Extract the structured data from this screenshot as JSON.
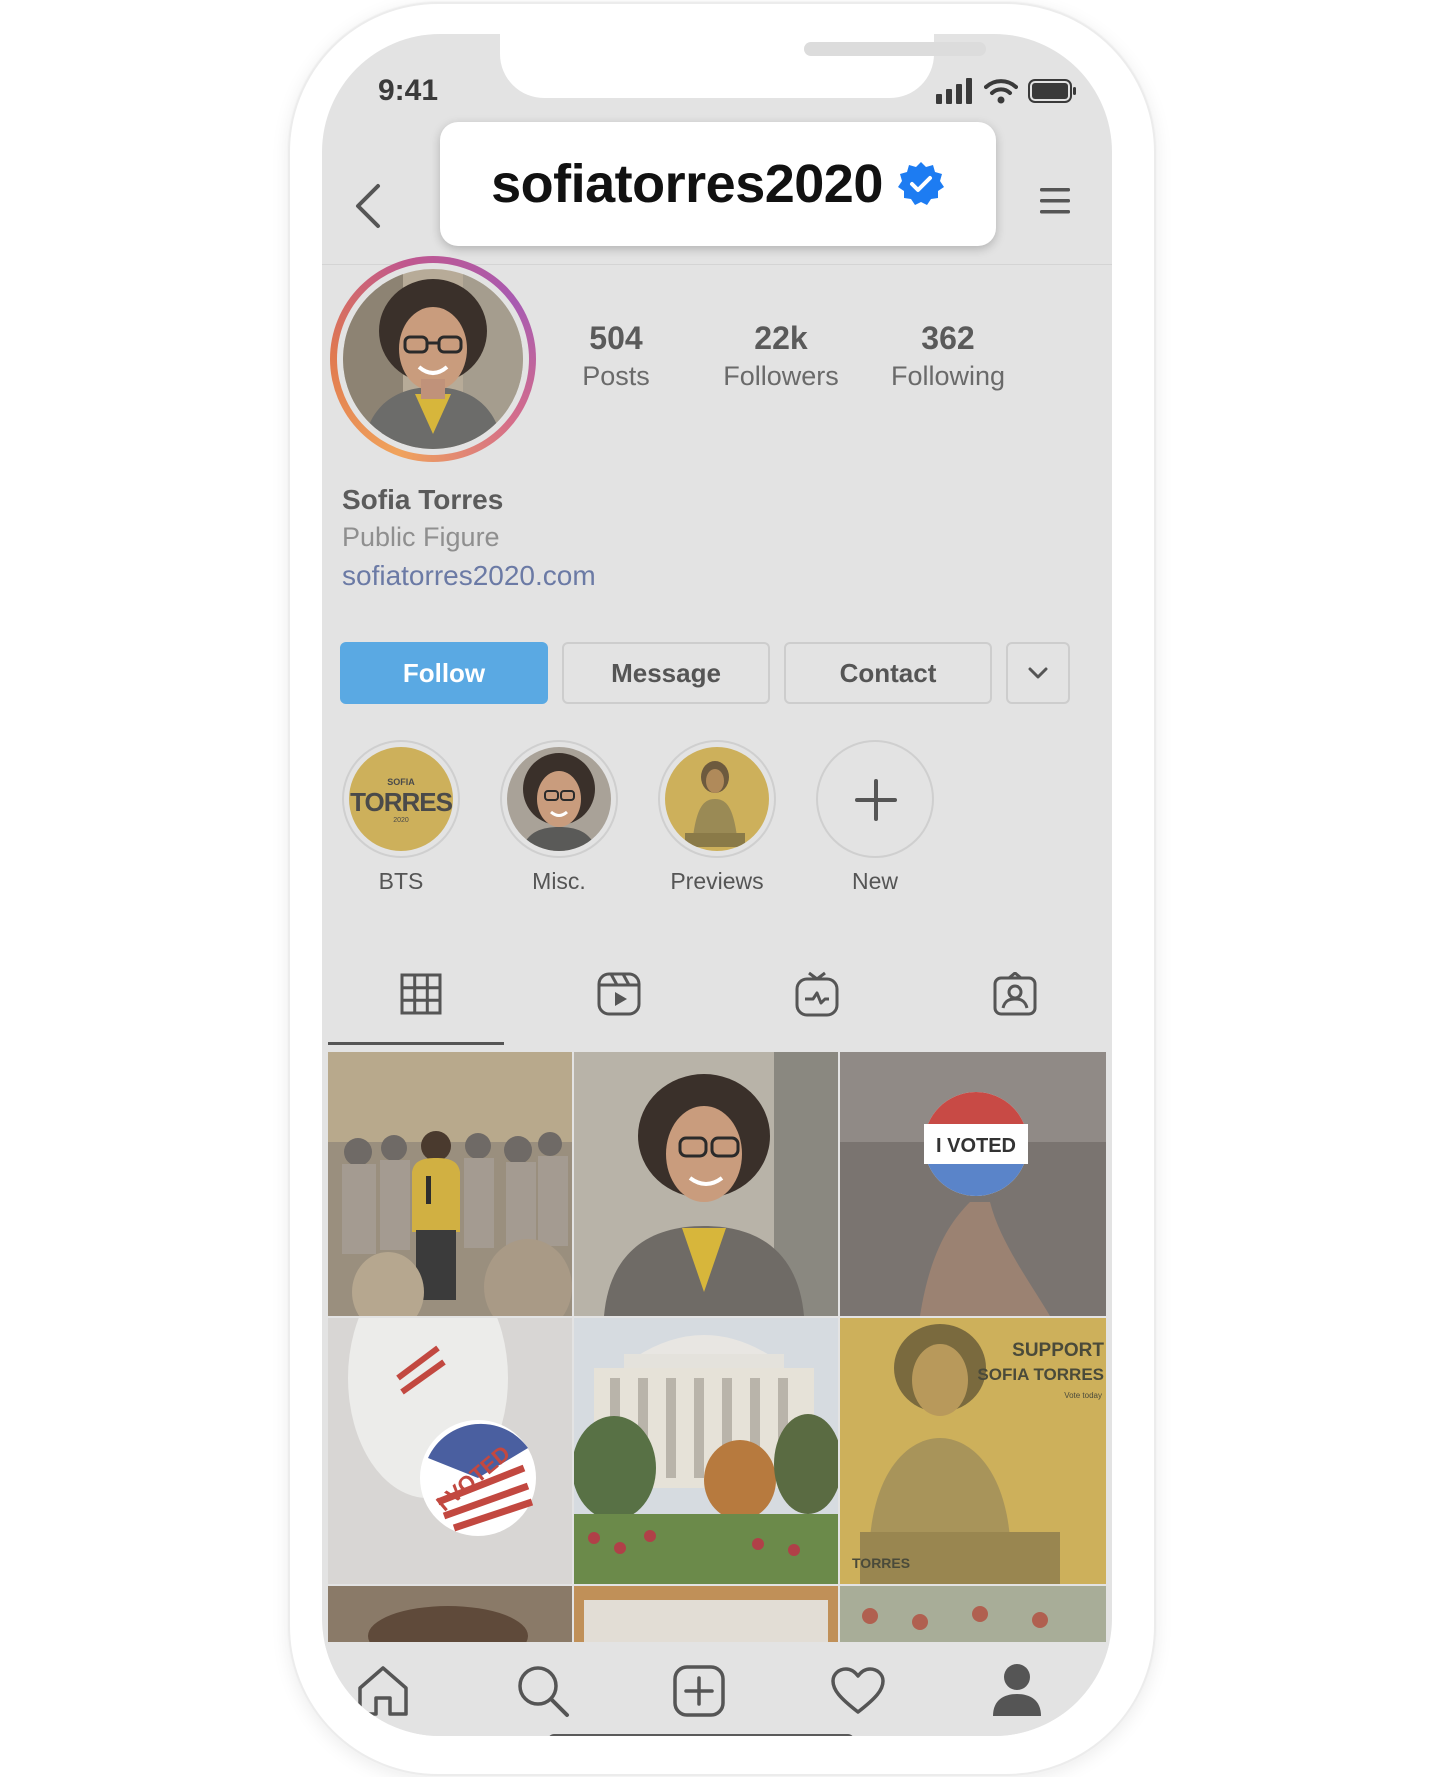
{
  "status_bar": {
    "time": "9:41"
  },
  "header": {
    "username": "sofiatorres2020",
    "verified_icon": "verified-badge-icon"
  },
  "profile": {
    "stats": [
      {
        "value": "504",
        "label": "Posts"
      },
      {
        "value": "22k",
        "label": "Followers"
      },
      {
        "value": "362",
        "label": "Following"
      }
    ],
    "name": "Sofia Torres",
    "category": "Public Figure",
    "website": "sofiatorres2020.com"
  },
  "actions": {
    "follow": "Follow",
    "message": "Message",
    "contact": "Contact"
  },
  "highlights": [
    {
      "label": "BTS",
      "logo_small": "SOFIA",
      "logo_big": "TORRES",
      "logo_year": "2020"
    },
    {
      "label": "Misc."
    },
    {
      "label": "Previews"
    },
    {
      "label": "New"
    }
  ],
  "posts": {
    "sticker_text": "I VOTED",
    "support_line1": "SUPPORT",
    "support_line2": "SOFIA TORRES",
    "support_sub": "Vote today",
    "support_logo": "TORRES"
  },
  "colors": {
    "follow_button": "#5aa9e3",
    "verified": "#1d7cf2",
    "link": "#6b7aa5"
  }
}
